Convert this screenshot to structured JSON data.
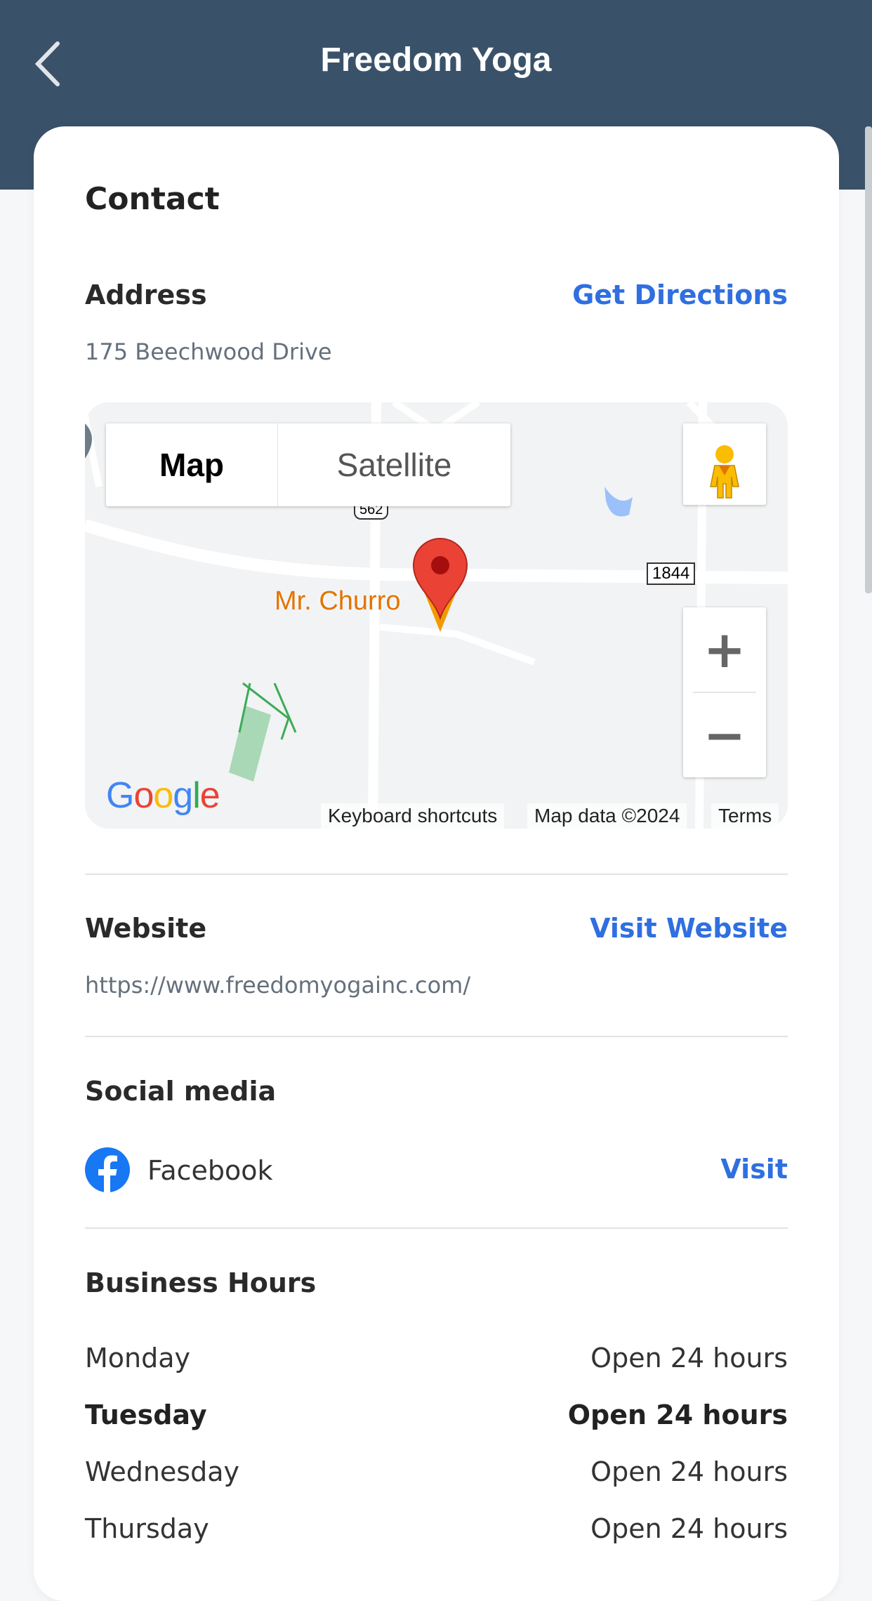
{
  "header": {
    "title": "Freedom Yoga",
    "back_icon": "chevron-left-icon"
  },
  "contact": {
    "title": "Contact",
    "address": {
      "label": "Address",
      "action": "Get Directions",
      "value": "175 Beechwood Drive"
    },
    "map": {
      "type_options": [
        "Map",
        "Satellite"
      ],
      "selected": "Map",
      "poi_label": "Mr. Churro",
      "road_labels": [
        "1844",
        "562"
      ],
      "attribution": {
        "shortcuts": "Keyboard shortcuts",
        "data": "Map data ©2024",
        "terms": "Terms"
      },
      "logo": "Google",
      "zoom_in": "+",
      "zoom_out": "−"
    },
    "website": {
      "label": "Website",
      "action": "Visit Website",
      "value": "https://www.freedomyogainc.com/"
    },
    "social": {
      "label": "Social media",
      "items": [
        {
          "name": "Facebook",
          "action": "Visit",
          "color": "#1877f2"
        }
      ]
    },
    "hours": {
      "label": "Business Hours",
      "days": [
        {
          "day": "Monday",
          "hours": "Open 24 hours",
          "today": false
        },
        {
          "day": "Tuesday",
          "hours": "Open 24 hours",
          "today": true
        },
        {
          "day": "Wednesday",
          "hours": "Open 24 hours",
          "today": false
        },
        {
          "day": "Thursday",
          "hours": "Open 24 hours",
          "today": false
        }
      ]
    }
  },
  "colors": {
    "header": "#3a5269",
    "link": "#2f6fe0"
  }
}
